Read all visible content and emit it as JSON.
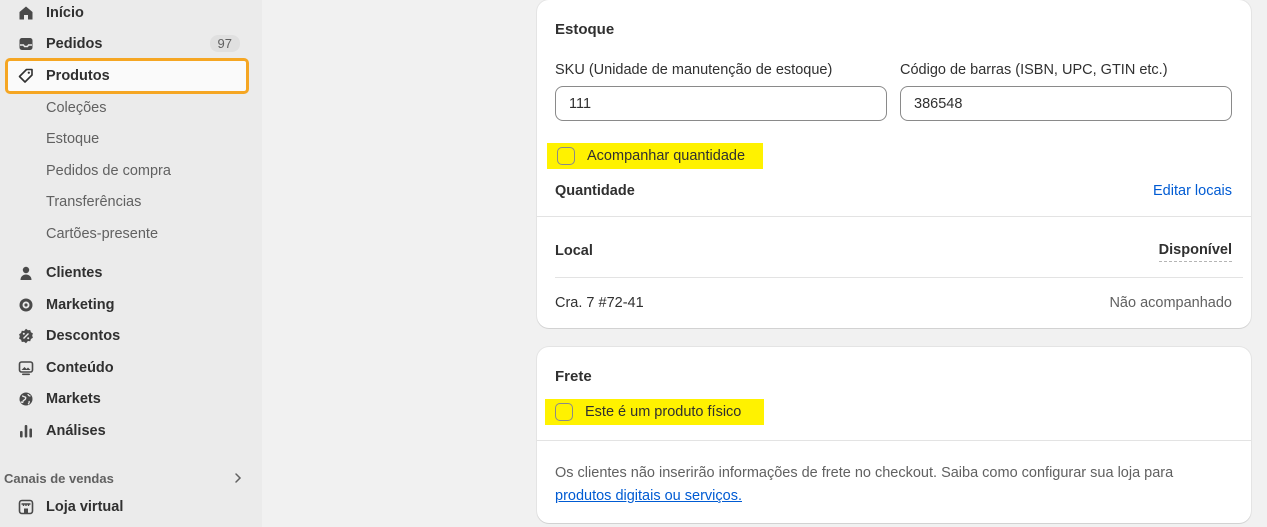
{
  "sidebar": {
    "items": [
      {
        "label": "Início",
        "icon": "home-icon"
      },
      {
        "label": "Pedidos",
        "icon": "inbox-icon",
        "badge": "97"
      },
      {
        "label": "Produtos",
        "icon": "tag-icon"
      },
      {
        "label": "Clientes",
        "icon": "person-icon"
      },
      {
        "label": "Marketing",
        "icon": "target-icon"
      },
      {
        "label": "Descontos",
        "icon": "discount-icon"
      },
      {
        "label": "Conteúdo",
        "icon": "image-icon"
      },
      {
        "label": "Markets",
        "icon": "globe-icon"
      },
      {
        "label": "Análises",
        "icon": "bar-chart-icon"
      }
    ],
    "sub_items": [
      "Coleções",
      "Estoque",
      "Pedidos de compra",
      "Transferências",
      "Cartões-presente"
    ],
    "sales_channels_label": "Canais de vendas",
    "online_store_label": "Loja virtual"
  },
  "inventory": {
    "title": "Estoque",
    "sku_label": "SKU (Unidade de manutenção de estoque)",
    "sku_value": "111",
    "barcode_label": "Código de barras (ISBN, UPC, GTIN etc.)",
    "barcode_value": "386548",
    "track_quantity_label": "Acompanhar quantidade",
    "quantity_label": "Quantidade",
    "edit_locations_label": "Editar locais",
    "table": {
      "headers": [
        "Local",
        "Disponível"
      ],
      "rows": [
        {
          "location": "Cra. 7 #72-41",
          "available": "Não acompanhado"
        }
      ]
    }
  },
  "shipping": {
    "title": "Frete",
    "physical_product_label": "Este é um produto físico",
    "info_text": "Os clientes não inserirão informações de frete no checkout. Saiba como configurar sua loja para",
    "info_link": "produtos digitais ou serviços."
  },
  "colors": {
    "highlight": "#fff200",
    "active_outline": "#f5a623",
    "link": "#005bd3"
  }
}
